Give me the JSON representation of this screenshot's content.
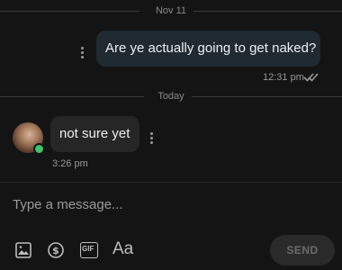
{
  "dividers": {
    "first_date": "Nov 11",
    "second_date": "Today"
  },
  "messages": [
    {
      "text": "Are ye actually going to get naked?",
      "time": "12:31 pm",
      "status_icon": "double-check-icon"
    },
    {
      "text": "not sure yet",
      "time": "3:26 pm"
    }
  ],
  "composer": {
    "placeholder": "Type a message...",
    "tools": [
      "image-icon",
      "dollar-icon",
      "gif-icon",
      "font-format-icon"
    ],
    "format_label": "Aa",
    "gif_label": "GIF",
    "send_label": "SEND"
  },
  "colors": {
    "outgoing_bubble": "#1f2a33",
    "incoming_bubble": "#262626",
    "online": "#3ec46d"
  }
}
